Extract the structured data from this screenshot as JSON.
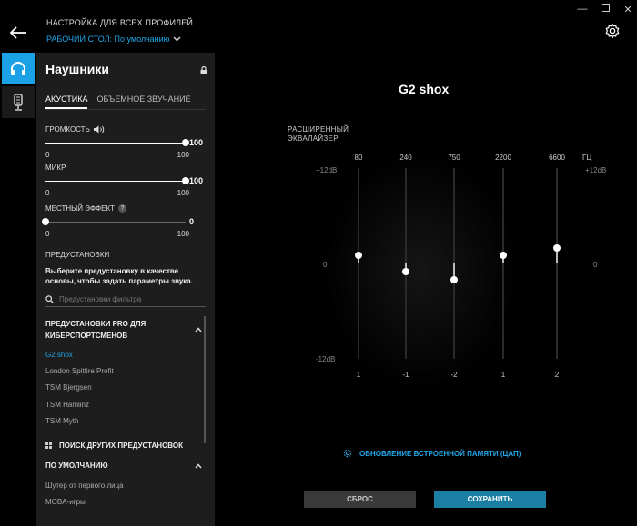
{
  "window": {
    "minimize": "—",
    "close": "✕"
  },
  "header": {
    "heading": "НАСТРОЙКА ДЛЯ ВСЕХ ПРОФИЛЕЙ",
    "profile": "РАБОЧИЙ СТОЛ: По умолчанию"
  },
  "panel": {
    "title": "Наушники",
    "tabs": [
      "АКУСТИКА",
      "ОБЪЕМНОЕ ЗВУЧАНИЕ"
    ],
    "sliders": [
      {
        "label": "ГРОМКОСТЬ",
        "value": "100",
        "min": "0",
        "max": "100",
        "level": 1.0
      },
      {
        "label": "МИКР",
        "value": "100",
        "min": "0",
        "max": "100",
        "level": 1.0
      },
      {
        "label": "МЕСТНЫЙ ЭФФЕКТ",
        "value": "0",
        "min": "0",
        "max": "100",
        "level": 0.0
      }
    ],
    "presets_label": "ПРЕДУСТАНОВКИ",
    "presets_desc": "Выберите предустановку в качестве основы, чтобы задать параметры звука.",
    "search_placeholder": "Предустановки фильтра",
    "pro_group": "ПРЕДУСТАНОВКИ PRO ДЛЯ КИБЕРСПОРТСМЕНОВ",
    "pro_presets": [
      "G2 shox",
      "London Spitfire Profit",
      "TSM Bjergsen",
      "TSM Hamlinz",
      "TSM Myth"
    ],
    "search_more": "ПОИСК ДРУГИХ ПРЕДУСТАНОВОК",
    "default_group": "ПО УМОЛЧАНИЮ",
    "default_presets": [
      "Шутер от первого лица",
      "MOBA-игры"
    ]
  },
  "main": {
    "device_title": "G2 shox",
    "eq_title": [
      "РАСШИРЕННЫЙ",
      "ЭКВАЛАЙЗЕР"
    ],
    "hz": "ГЦ",
    "db_top": "+12dB",
    "db_mid": "0",
    "db_bottom": "-12dB",
    "firmware_update": "ОБНОВЛЕНИЕ ВСТРОЕННОЙ ПАМЯТИ (ЦАП)",
    "reset_label": "СБРОС",
    "save_label": "СОХРАНИТЬ"
  },
  "equalizer": {
    "range_db": [
      -12,
      12
    ],
    "bands": [
      {
        "freq": "80",
        "gain": 1,
        "gain_label": "1"
      },
      {
        "freq": "240",
        "gain": -1,
        "gain_label": "-1"
      },
      {
        "freq": "750",
        "gain": -2,
        "gain_label": "-2"
      },
      {
        "freq": "2200",
        "gain": 1,
        "gain_label": "1"
      },
      {
        "freq": "6600",
        "gain": 2,
        "gain_label": "2"
      }
    ]
  },
  "colors": {
    "accent": "#1aa1e6",
    "save": "#1b7ea3",
    "panel": "#1d1d1d"
  },
  "icons": [
    "back-icon",
    "gear-icon",
    "headset-icon",
    "mic-icon",
    "lock-icon",
    "speaker-icon",
    "help-icon",
    "search-icon",
    "chevron-up-icon",
    "chevron-down-icon",
    "grid-icon",
    "firmware-gear-icon"
  ]
}
